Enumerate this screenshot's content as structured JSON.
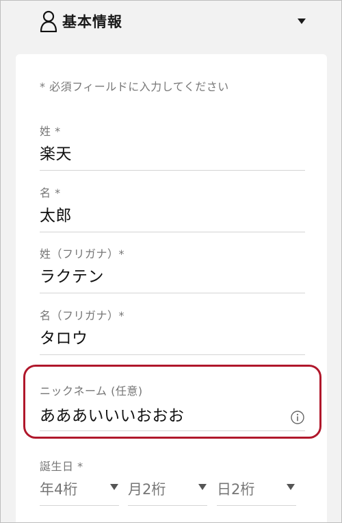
{
  "section": {
    "title": "基本情報",
    "icon": "user-icon",
    "toggle_icon": "triangle-down-icon"
  },
  "form": {
    "required_note": "* 必須フィールドに入力してください",
    "fields": [
      {
        "label": "姓 *",
        "value": "楽天"
      },
      {
        "label": "名 *",
        "value": "太郎"
      },
      {
        "label": "姓（フリガナ）*",
        "value": "ラクテン"
      },
      {
        "label": "名（フリガナ）*",
        "value": "タロウ"
      },
      {
        "label": "ニックネーム (任意)",
        "value": "あああいいいおおお",
        "info_icon": "info-icon"
      }
    ],
    "birthday": {
      "label": "誕生日 *",
      "year_placeholder": "年4桁",
      "month_placeholder": "月2桁",
      "day_placeholder": "日2桁"
    }
  },
  "colors": {
    "highlight": "#b0172b",
    "background": "#f2f2f2",
    "card": "#ffffff"
  }
}
